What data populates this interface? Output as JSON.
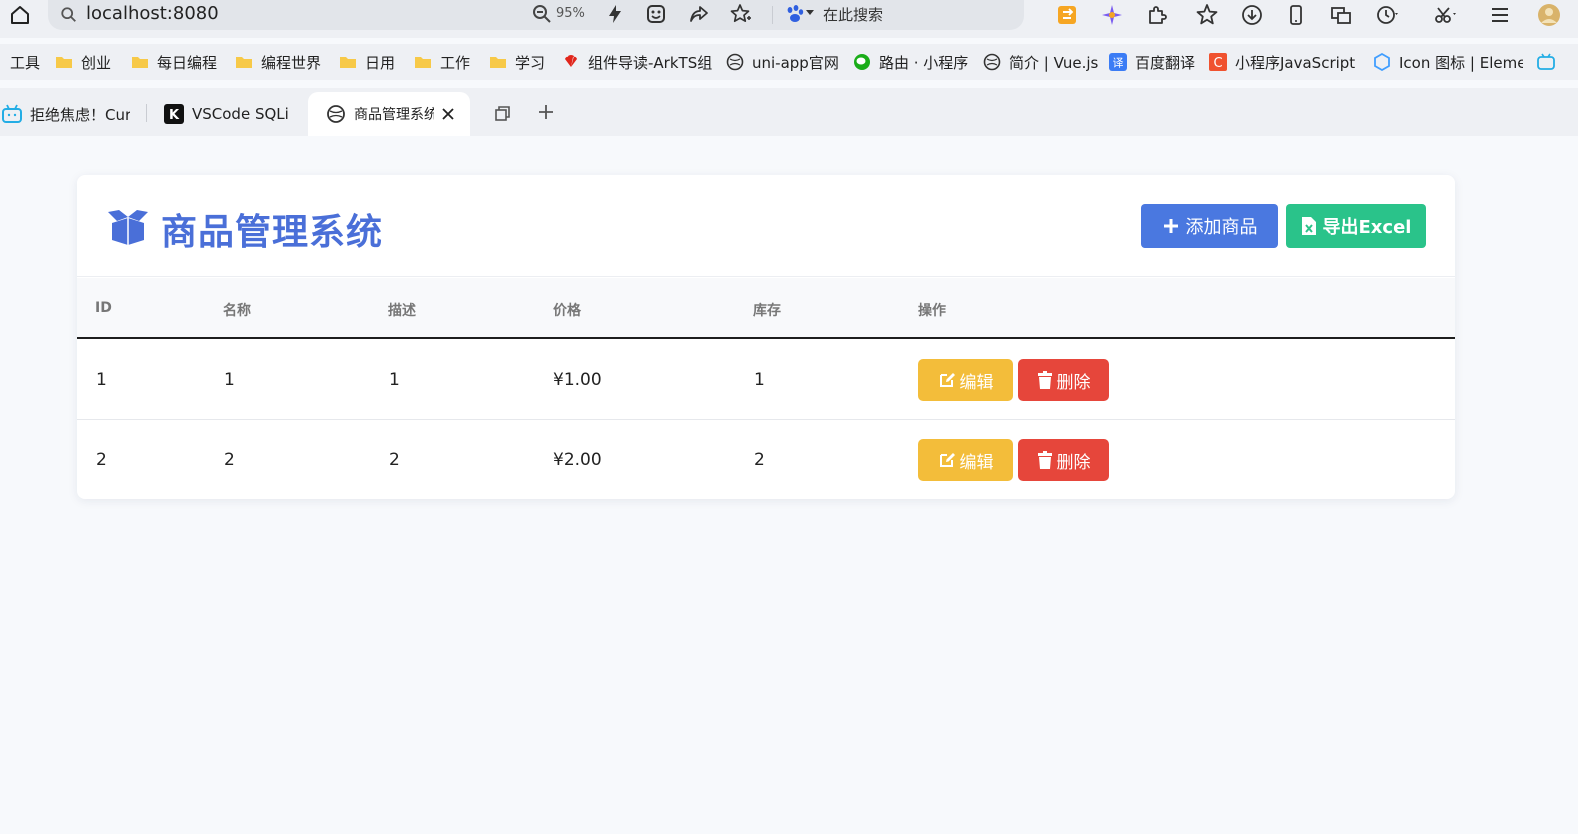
{
  "browser": {
    "url": "localhost:8080",
    "zoom": "95%",
    "search_placeholder": "在此搜索"
  },
  "bookmarks": [
    {
      "label": "工具",
      "icon": "none"
    },
    {
      "label": "创业",
      "icon": "folder-icon"
    },
    {
      "label": "每日编程",
      "icon": "folder-icon"
    },
    {
      "label": "编程世界",
      "icon": "folder-icon"
    },
    {
      "label": "日用",
      "icon": "folder-icon"
    },
    {
      "label": "工作",
      "icon": "folder-icon"
    },
    {
      "label": "学习",
      "icon": "folder-icon"
    },
    {
      "label": "组件导读-ArkTS组",
      "icon": "huawei-icon"
    },
    {
      "label": "uni-app官网",
      "icon": "globe-icon"
    },
    {
      "label": "路由 · 小程序",
      "icon": "wechat-icon"
    },
    {
      "label": "简介 | Vue.js",
      "icon": "globe-icon"
    },
    {
      "label": "百度翻译",
      "icon": "translate-icon"
    },
    {
      "label": "小程序JavaScript",
      "icon": "c-icon"
    },
    {
      "label": "Icon 图标 | Eleme",
      "icon": "element-icon"
    }
  ],
  "tabs": [
    {
      "label": "拒绝焦虑！Cur",
      "icon": "bilibili-icon",
      "active": false
    },
    {
      "label": "VSCode SQLi",
      "icon": "k-icon",
      "active": false
    },
    {
      "label": "商品管理系统",
      "icon": "globe-icon",
      "active": true
    }
  ],
  "page": {
    "title": "商品管理系统",
    "add_button": "添加商品",
    "export_button": "导出Excel"
  },
  "table": {
    "columns": [
      "ID",
      "名称",
      "描述",
      "价格",
      "库存",
      "操作"
    ],
    "rows": [
      {
        "id": "1",
        "name": "1",
        "desc": "1",
        "price": "¥1.00",
        "stock": "1"
      },
      {
        "id": "2",
        "name": "2",
        "desc": "2",
        "price": "¥2.00",
        "stock": "2"
      }
    ],
    "edit_label": "编辑",
    "delete_label": "删除"
  },
  "colors": {
    "primary": "#4a78e0",
    "title": "#4a6fd8",
    "success": "#2ac38a",
    "warning": "#f3bd3a",
    "danger": "#e6463b"
  }
}
